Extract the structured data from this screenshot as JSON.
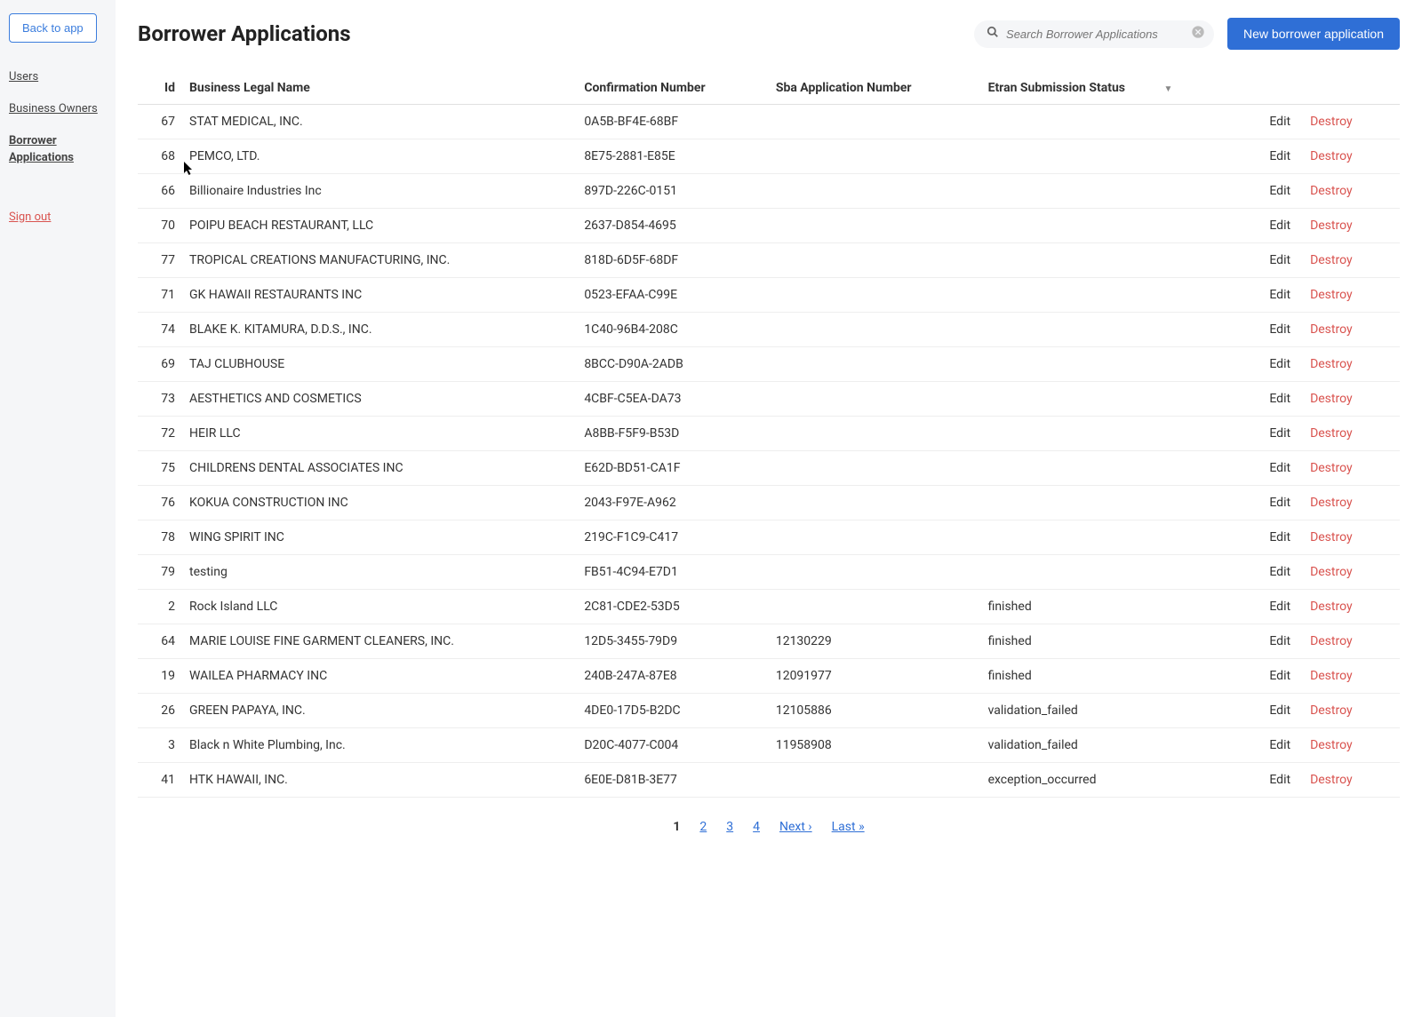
{
  "sidebar": {
    "back_label": "Back to app",
    "links": [
      {
        "label": "Users"
      },
      {
        "label": "Business Owners"
      },
      {
        "label": "Borrower Applications"
      }
    ],
    "signout_label": "Sign out"
  },
  "header": {
    "title": "Borrower Applications",
    "search_placeholder": "Search Borrower Applications",
    "new_button_label": "New borrower application"
  },
  "table": {
    "headers": {
      "id": "Id",
      "business_name": "Business Legal Name",
      "confirmation": "Confirmation Number",
      "sba": "Sba Application Number",
      "etran": "Etran Submission Status"
    },
    "edit_label": "Edit",
    "destroy_label": "Destroy",
    "rows": [
      {
        "id": "67",
        "name": "STAT MEDICAL, INC.",
        "conf": "0A5B-BF4E-68BF",
        "sba": "",
        "etran": ""
      },
      {
        "id": "68",
        "name": "PEMCO, LTD.",
        "conf": "8E75-2881-E85E",
        "sba": "",
        "etran": ""
      },
      {
        "id": "66",
        "name": "Billionaire Industries Inc",
        "conf": "897D-226C-0151",
        "sba": "",
        "etran": ""
      },
      {
        "id": "70",
        "name": "POIPU BEACH RESTAURANT, LLC",
        "conf": "2637-D854-4695",
        "sba": "",
        "etran": ""
      },
      {
        "id": "77",
        "name": "TROPICAL CREATIONS MANUFACTURING, INC.",
        "conf": "818D-6D5F-68DF",
        "sba": "",
        "etran": ""
      },
      {
        "id": "71",
        "name": "GK HAWAII RESTAURANTS INC",
        "conf": "0523-EFAA-C99E",
        "sba": "",
        "etran": ""
      },
      {
        "id": "74",
        "name": "BLAKE K. KITAMURA, D.D.S., INC.",
        "conf": "1C40-96B4-208C",
        "sba": "",
        "etran": ""
      },
      {
        "id": "69",
        "name": "TAJ CLUBHOUSE",
        "conf": "8BCC-D90A-2ADB",
        "sba": "",
        "etran": ""
      },
      {
        "id": "73",
        "name": "AESTHETICS AND COSMETICS",
        "conf": "4CBF-C5EA-DA73",
        "sba": "",
        "etran": ""
      },
      {
        "id": "72",
        "name": "HEIR LLC",
        "conf": "A8BB-F5F9-B53D",
        "sba": "",
        "etran": ""
      },
      {
        "id": "75",
        "name": "CHILDRENS DENTAL ASSOCIATES INC",
        "conf": "E62D-BD51-CA1F",
        "sba": "",
        "etran": ""
      },
      {
        "id": "76",
        "name": "KOKUA CONSTRUCTION INC",
        "conf": "2043-F97E-A962",
        "sba": "",
        "etran": ""
      },
      {
        "id": "78",
        "name": "WING SPIRIT INC",
        "conf": "219C-F1C9-C417",
        "sba": "",
        "etran": ""
      },
      {
        "id": "79",
        "name": "testing",
        "conf": "FB51-4C94-E7D1",
        "sba": "",
        "etran": ""
      },
      {
        "id": "2",
        "name": "Rock Island LLC",
        "conf": "2C81-CDE2-53D5",
        "sba": "",
        "etran": "finished"
      },
      {
        "id": "64",
        "name": "MARIE LOUISE FINE GARMENT CLEANERS, INC.",
        "conf": "12D5-3455-79D9",
        "sba": "12130229",
        "etran": "finished"
      },
      {
        "id": "19",
        "name": "WAILEA PHARMACY INC",
        "conf": "240B-247A-87E8",
        "sba": "12091977",
        "etran": "finished"
      },
      {
        "id": "26",
        "name": "GREEN PAPAYA, INC.",
        "conf": "4DE0-17D5-B2DC",
        "sba": "12105886",
        "etran": "validation_failed"
      },
      {
        "id": "3",
        "name": "Black n White Plumbing, Inc.",
        "conf": "D20C-4077-C004",
        "sba": "11958908",
        "etran": "validation_failed"
      },
      {
        "id": "41",
        "name": "HTK HAWAII, INC.",
        "conf": "6E0E-D81B-3E77",
        "sba": "",
        "etran": "exception_occurred"
      }
    ]
  },
  "pagination": {
    "current": "1",
    "pages": [
      "2",
      "3",
      "4"
    ],
    "next_label": "Next ›",
    "last_label": "Last »"
  }
}
